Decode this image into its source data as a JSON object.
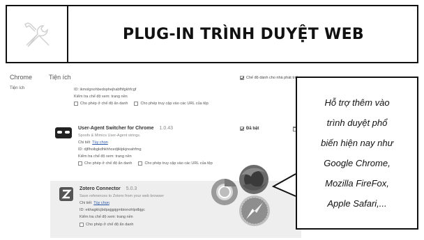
{
  "header": {
    "title": "PLUG-IN TRÌNH DUYỆT WEB",
    "icon": "wrench-screwdriver-icon"
  },
  "chrome": {
    "sidebar_title": "Chrome",
    "sidebar_link": "Tiện ích",
    "main_title": "Tiện ích",
    "dev_mode_label": "Chế độ dành cho nhà phát triển",
    "ext_top": {
      "id_line": "ID: ikmolgnohbedophejhabfhfgkhfcgf",
      "inspect": "Kiểm tra chế độ xem: trang nền",
      "incognito": "Cho phép ở chế độ ẩn danh",
      "file_urls": "Cho phép truy cập vào các URL của tệp"
    },
    "ext_ua": {
      "name": "User-Agent Switcher for Chrome",
      "version": "1.0.43",
      "desc": "Spoofs & Mimics User-Agent strings.",
      "details": "Chi tiết",
      "options": "Tùy chọn",
      "id_line": "ID: djflhoibgkdhkhhcedjiklpkjnoahfmg",
      "inspect": "Kiểm tra chế độ xem: trang nền",
      "incognito": "Cho phép ở chế độ ẩn danh",
      "file_urls": "Cho phép truy cập vào các URL của tệp",
      "enabled": "Đã bật"
    },
    "ext_zotero": {
      "name": "Zotero Connector",
      "version": "5.0.3",
      "desc": "Save references to Zotero from your web browser",
      "details": "Chi tiết",
      "options": "Tùy chọn",
      "id_line": "ID: ekhagklcjbdpajgpjgmbionohlpdbjgc",
      "inspect": "Kiểm tra chế độ xem: trang nền",
      "incognito": "Cho phép ở chế độ ẩn danh"
    }
  },
  "callout": {
    "lines": [
      "Hỗ trợ thêm vào",
      "trình duyệt phổ",
      "biến hiện nay như",
      "Google Chrome,",
      "Mozilla FireFox,",
      "Apple Safari,..."
    ]
  },
  "colors": {
    "link": "#2a56a8",
    "row_bg": "#eeeeee",
    "border": "#111111"
  }
}
